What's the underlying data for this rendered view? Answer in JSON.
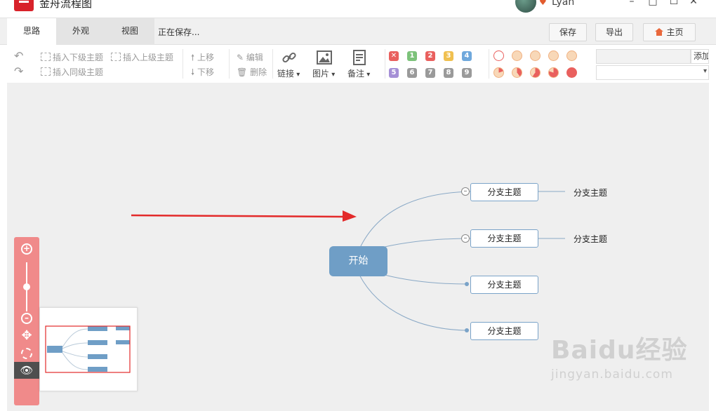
{
  "app": {
    "title": "金舟流程图"
  },
  "user": {
    "name": "Lyan"
  },
  "window_controls": {
    "minimize": "–",
    "maximize": "☐",
    "close": "✕"
  },
  "tabs": [
    {
      "label": "思路",
      "active": true
    },
    {
      "label": "外观",
      "active": false
    },
    {
      "label": "视图",
      "active": false
    }
  ],
  "status": {
    "saving": "正在保存..."
  },
  "header_buttons": {
    "save": "保存",
    "export": "导出",
    "home": "主页"
  },
  "toolbar": {
    "insert_child": "插入下级主题",
    "insert_parent": "插入上级主题",
    "insert_sibling": "插入同级主题",
    "move_up": "上移",
    "move_down": "下移",
    "edit": "编辑",
    "delete": "删除",
    "link": "链接",
    "image": "图片",
    "note": "备注",
    "add_label": "添加"
  },
  "priority_icons": [
    {
      "label": "✕",
      "color": "#e9605e"
    },
    {
      "label": "1",
      "color": "#7cc27a"
    },
    {
      "label": "2",
      "color": "#e9605e"
    },
    {
      "label": "3",
      "color": "#f0c050"
    },
    {
      "label": "4",
      "color": "#6fa8dc"
    },
    {
      "label": "5",
      "color": "#a58fd6"
    },
    {
      "label": "6",
      "color": "#9a9a9a"
    },
    {
      "label": "7",
      "color": "#9a9a9a"
    },
    {
      "label": "8",
      "color": "#9a9a9a"
    },
    {
      "label": "9",
      "color": "#9a9a9a"
    }
  ],
  "mindmap": {
    "root": "开始",
    "branches": [
      "分支主题",
      "分支主题",
      "分支主题",
      "分支主题"
    ],
    "sub_topics": [
      "分支主题",
      "分支主题"
    ]
  },
  "zoom_panel": {
    "zoom_in": "+",
    "zoom_out": "–",
    "level": 0.5
  },
  "watermark": {
    "logo": "Baidu经验",
    "url": "jingyan.baidu.com"
  },
  "colors": {
    "accent_red": "#d8222a",
    "root_node": "#6f9ec6",
    "branch_border": "#7aa3c8",
    "zoom_panel": "#f08a8a",
    "arrow": "#e32a2a"
  }
}
